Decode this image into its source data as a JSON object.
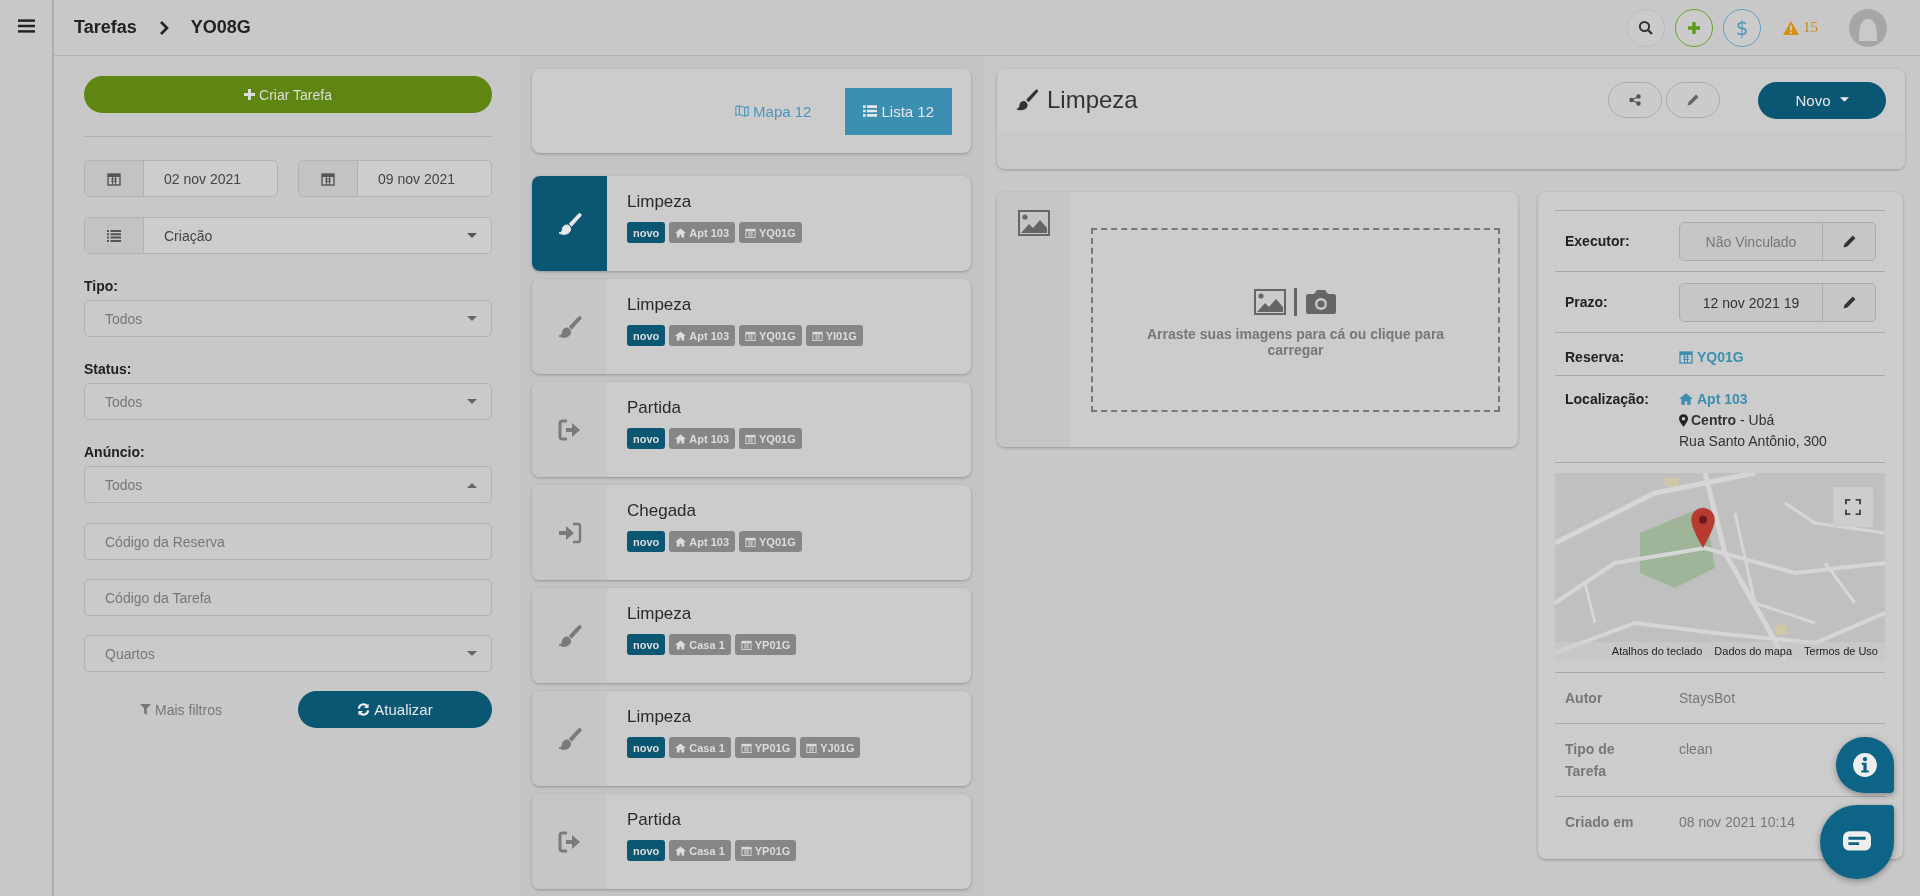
{
  "breadcrumb": [
    "Tarefas",
    "YO08G"
  ],
  "header": {
    "currency_button": "$",
    "alerts": "15"
  },
  "filters": {
    "create_button": "Criar Tarefa",
    "date_from": "02 nov 2021",
    "date_to": "09 nov 2021",
    "sort": "Criação",
    "selects": [
      {
        "label": "Tipo:",
        "value": "Todos",
        "expanded": false
      },
      {
        "label": "Status:",
        "value": "Todos",
        "expanded": false
      },
      {
        "label": "Anúncio:",
        "value": "Todos",
        "expanded": true
      }
    ],
    "booking_code_placeholder": "Código da Reserva",
    "task_code_placeholder": "Código da Tarefa",
    "rooms_placeholder": "Quartos",
    "more_filters": "Mais filtros",
    "refresh_button": "Atualizar"
  },
  "view_tabs": [
    {
      "label": "Mapa 12",
      "kind": "map",
      "selected": false
    },
    {
      "label": "Lista 12",
      "kind": "list",
      "selected": true
    }
  ],
  "tasks": [
    {
      "title": "Limpeza",
      "kind": "cleaning",
      "selected": true,
      "status": "novo",
      "place": "Apt 103",
      "bookings": [
        "YQ01G"
      ]
    },
    {
      "title": "Limpeza",
      "kind": "cleaning",
      "selected": false,
      "status": "novo",
      "place": "Apt 103",
      "bookings": [
        "YQ01G",
        "YI01G"
      ]
    },
    {
      "title": "Partida",
      "kind": "checkout",
      "selected": false,
      "status": "novo",
      "place": "Apt 103",
      "bookings": [
        "YQ01G"
      ]
    },
    {
      "title": "Chegada",
      "kind": "checkin",
      "selected": false,
      "status": "novo",
      "place": "Apt 103",
      "bookings": [
        "YQ01G"
      ]
    },
    {
      "title": "Limpeza",
      "kind": "cleaning",
      "selected": false,
      "status": "novo",
      "place": "Casa 1",
      "bookings": [
        "YP01G"
      ]
    },
    {
      "title": "Limpeza",
      "kind": "cleaning",
      "selected": false,
      "status": "novo",
      "place": "Casa 1",
      "bookings": [
        "YP01G",
        "YJ01G"
      ]
    },
    {
      "title": "Partida",
      "kind": "checkout",
      "selected": false,
      "status": "novo",
      "place": "Casa 1",
      "bookings": [
        "YP01G"
      ]
    }
  ],
  "detail": {
    "title": "Limpeza",
    "kind": "cleaning",
    "new_button": "Novo",
    "upload_hint": "Arraste suas imagens para cá ou clique para carregar",
    "executor": {
      "label": "Executor:",
      "value": "Não Vinculado"
    },
    "deadline": {
      "label": "Prazo:",
      "value": "12 nov 2021 19"
    },
    "booking": {
      "label": "Reserva:",
      "value": "YQ01G"
    },
    "location": {
      "label": "Localização:",
      "place": "Apt 103",
      "area": "**Centro** - Ubá",
      "address": "Rua Santo Antônio, 300"
    },
    "map": {
      "kind": "picture",
      "attribution": [
        "Atalhos do teclado",
        "Dados do mapa",
        "Termos de Uso"
      ]
    },
    "meta": [
      {
        "label": "Autor",
        "value": "StaysBot"
      },
      {
        "label": "Tipo de Tarefa",
        "value": "clean"
      },
      {
        "label": "Criado em",
        "value": "08 nov 2021 10:14"
      }
    ]
  }
}
